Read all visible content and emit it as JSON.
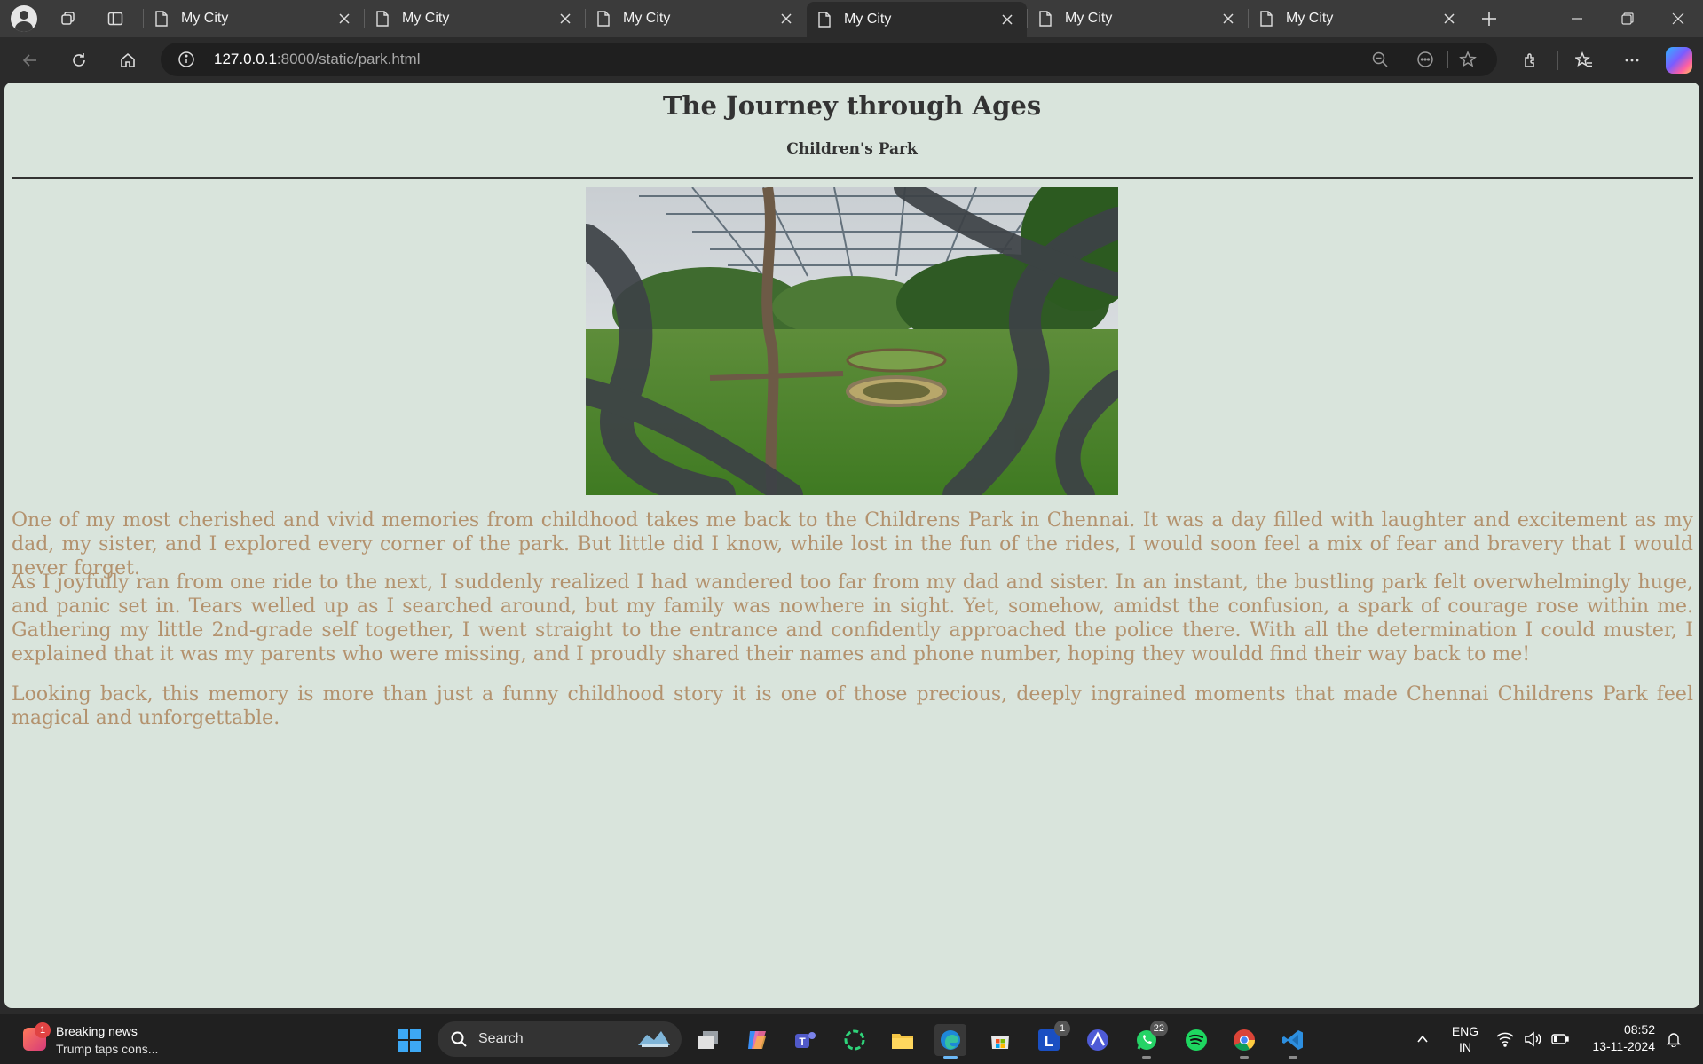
{
  "browser": {
    "tabs": [
      {
        "title": "My City",
        "active": false
      },
      {
        "title": "My City",
        "active": false
      },
      {
        "title": "My City",
        "active": false
      },
      {
        "title": "My City",
        "active": true
      },
      {
        "title": "My City",
        "active": false
      },
      {
        "title": "My City",
        "active": false
      }
    ],
    "address": {
      "host": "127.0.0.1",
      "rest": ":8000/static/park.html"
    },
    "accent": "#2b2b2b"
  },
  "page": {
    "title": "The Journey through Ages",
    "subtitle": "Children's Park",
    "background": "#d9e4dc",
    "text_color": "#b3926e",
    "paragraphs": [
      "One of my most cherished and vivid memories from childhood takes me back to the Childrens Park in Chennai. It was a day filled with laughter and excitement as my dad, my sister, and I explored every corner of the park. But little did I know, while lost in the fun of the rides, I would soon feel a mix of fear and bravery that I would never forget.",
      "As I joyfully ran from one ride to the next, I suddenly realized I had wandered too far from my dad and sister. In an instant, the bustling park felt overwhelmingly huge, and panic set in. Tears welled up as I searched around, but my family was nowhere in sight. Yet, somehow, amidst the confusion, a spark of courage rose within me. Gathering my little 2nd-grade self together, I went straight to the entrance and confidently approached the police there. With all the determination I could muster, I explained that it was my parents who were missing, and I proudly shared their names and phone number, hoping they wouldd find their way back to me!",
      "Looking back, this memory is more than just a funny childhood story it is one of those precious, deeply ingrained moments that made Chennai Childrens Park feel magical and unforgettable."
    ]
  },
  "taskbar": {
    "news": {
      "title": "Breaking news",
      "snippet": "Trump taps cons...",
      "badge": "1"
    },
    "search_placeholder": "Search",
    "apps": [
      {
        "name": "start-icon"
      },
      {
        "name": "task-view-icon"
      },
      {
        "name": "copilot-app-icon"
      },
      {
        "name": "teams-icon"
      },
      {
        "name": "circle-app-icon"
      },
      {
        "name": "file-explorer-icon"
      },
      {
        "name": "edge-icon",
        "active": true
      },
      {
        "name": "store-icon"
      },
      {
        "name": "l-app-icon",
        "badge": "1"
      },
      {
        "name": "arc-app-icon"
      },
      {
        "name": "whatsapp-icon",
        "badge": "22"
      },
      {
        "name": "spotify-icon"
      },
      {
        "name": "chrome-icon"
      },
      {
        "name": "vscode-icon"
      }
    ],
    "language": {
      "line1": "ENG",
      "line2": "IN"
    },
    "time": "08:52",
    "date": "13-11-2024"
  }
}
